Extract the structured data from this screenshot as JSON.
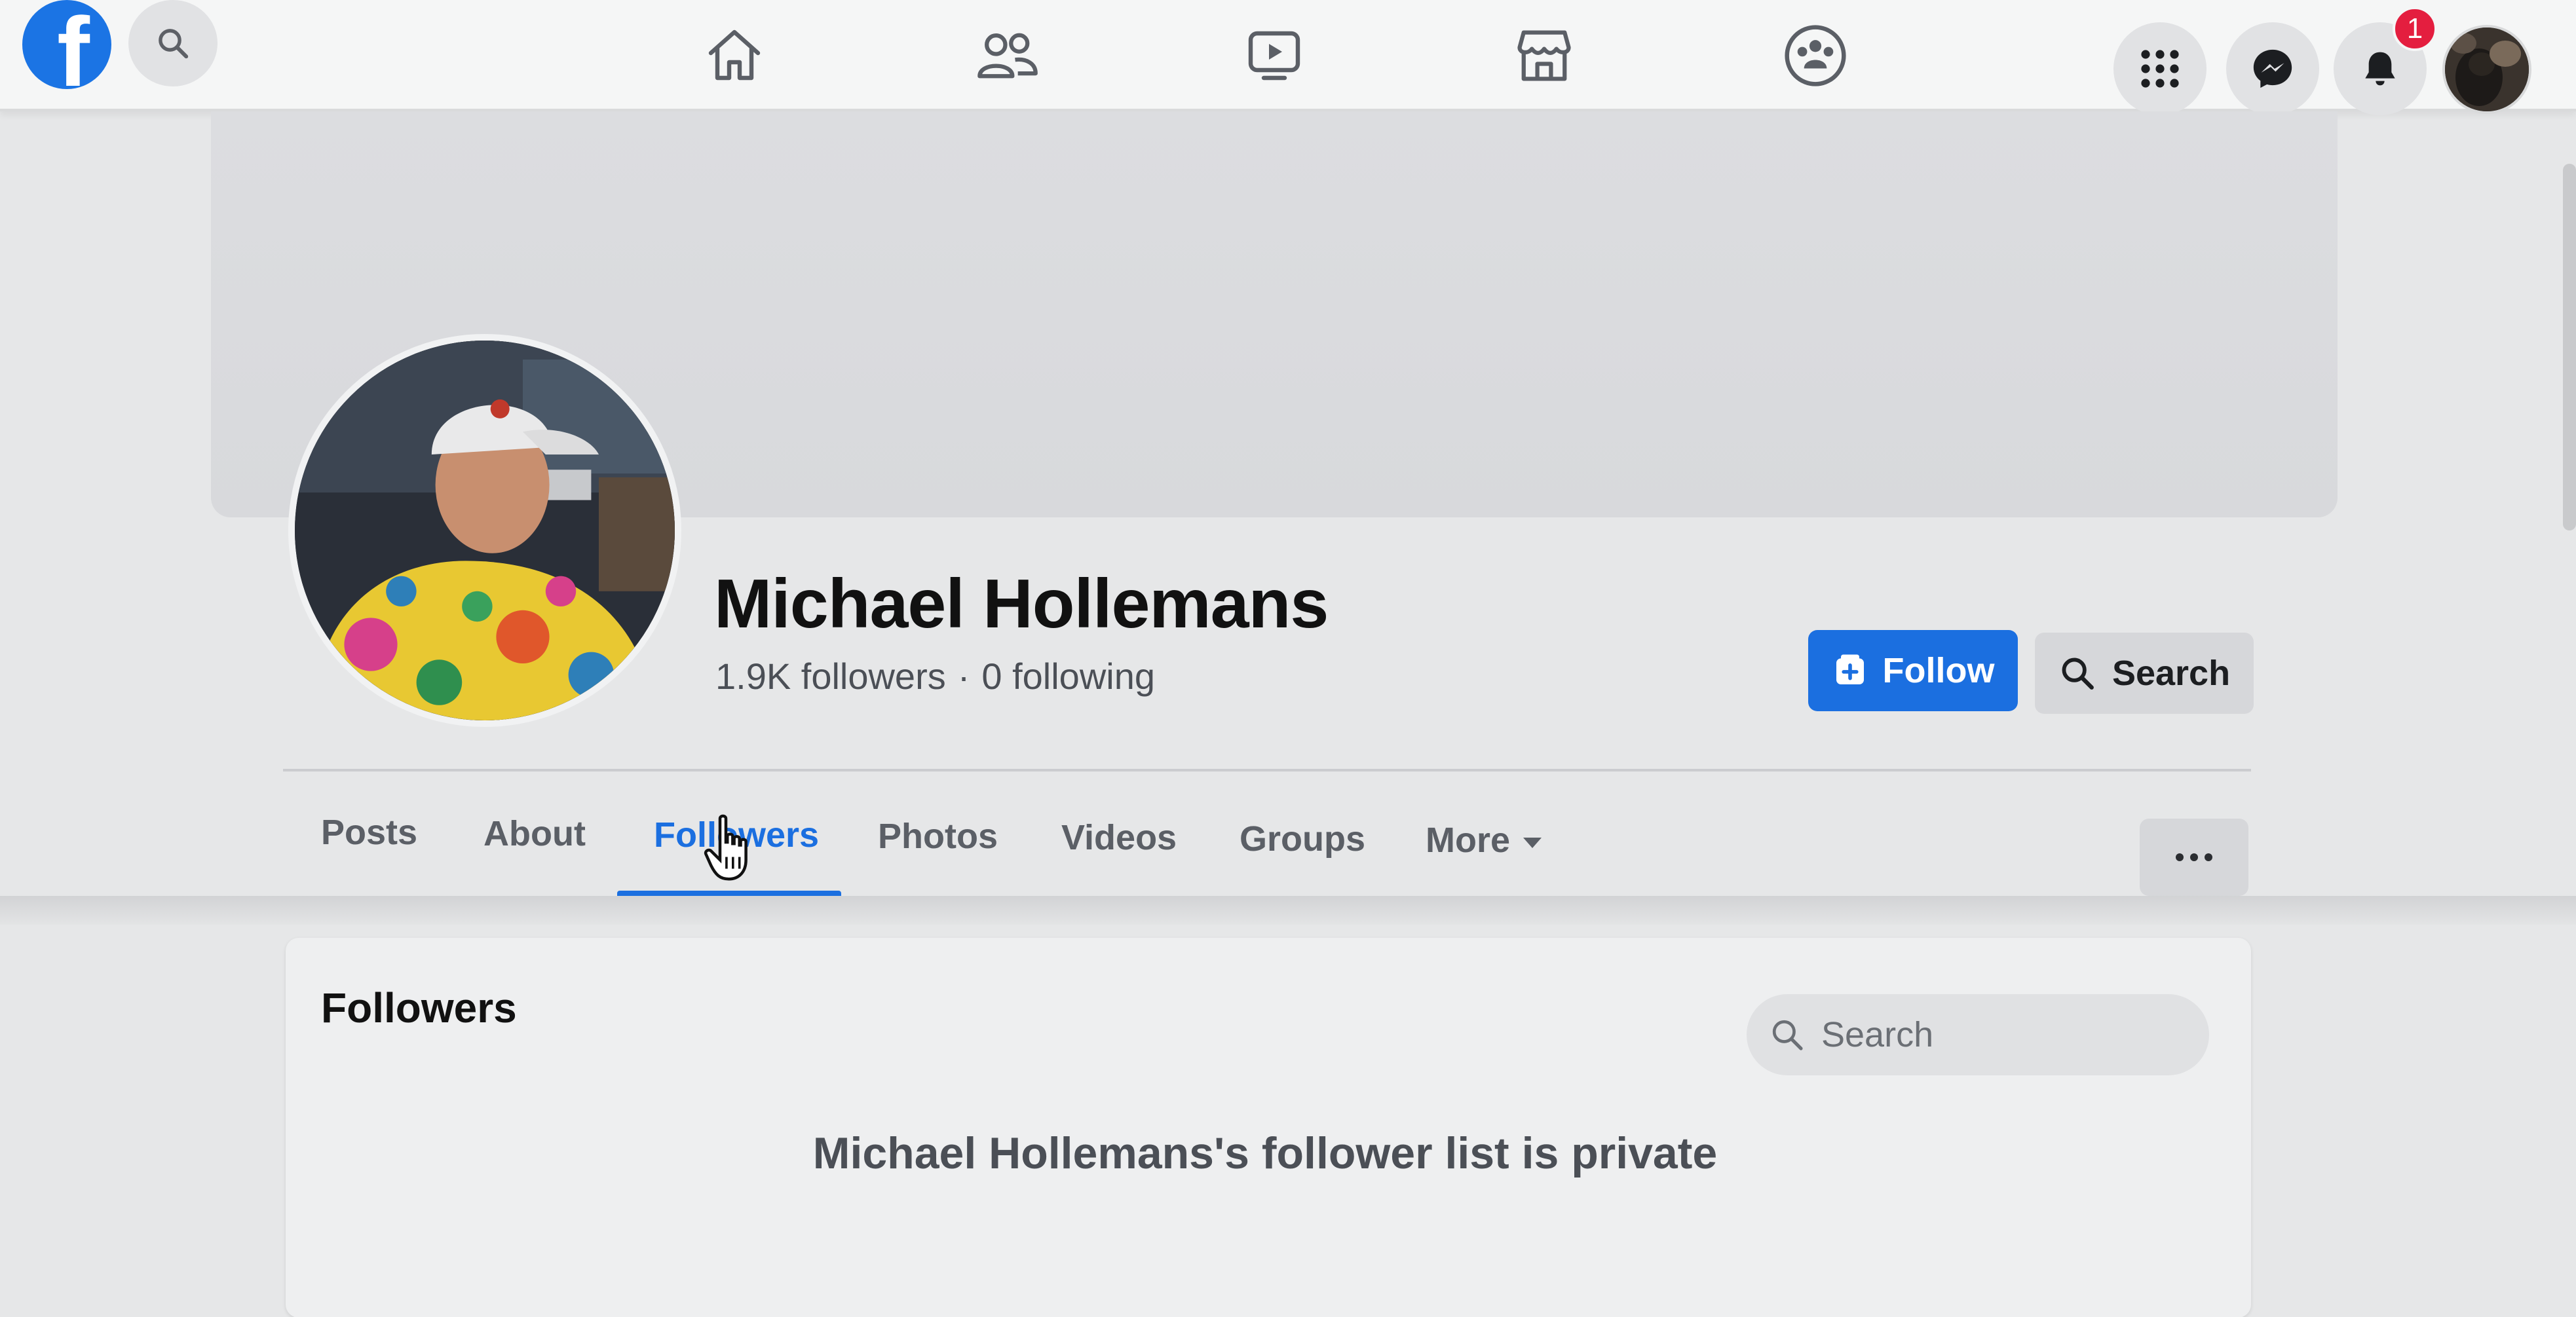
{
  "topbar": {
    "logo_letter": "f",
    "notification_count": "1",
    "icons": [
      "search-icon",
      "home-icon",
      "friends-icon",
      "watch-icon",
      "marketplace-icon",
      "groups-icon",
      "menu-grid-icon",
      "messenger-icon",
      "bell-icon"
    ]
  },
  "profile": {
    "name": "Michael Hollemans",
    "followers": "1.9K followers",
    "separator": "·",
    "following": "0 following",
    "follow_label": "Follow",
    "search_label": "Search"
  },
  "tabs": [
    {
      "label": "Posts",
      "active": false
    },
    {
      "label": "About",
      "active": false
    },
    {
      "label": "Followers",
      "active": true
    },
    {
      "label": "Photos",
      "active": false
    },
    {
      "label": "Videos",
      "active": false
    },
    {
      "label": "Groups",
      "active": false
    },
    {
      "label": "More",
      "active": false
    }
  ],
  "followers_card": {
    "title": "Followers",
    "search_placeholder": "Search",
    "private_message": "Michael Hollemans's follower list is private"
  },
  "colors": {
    "accent": "#1b6fe0",
    "badge": "#e41e3f",
    "logo": "#1b74e4"
  }
}
